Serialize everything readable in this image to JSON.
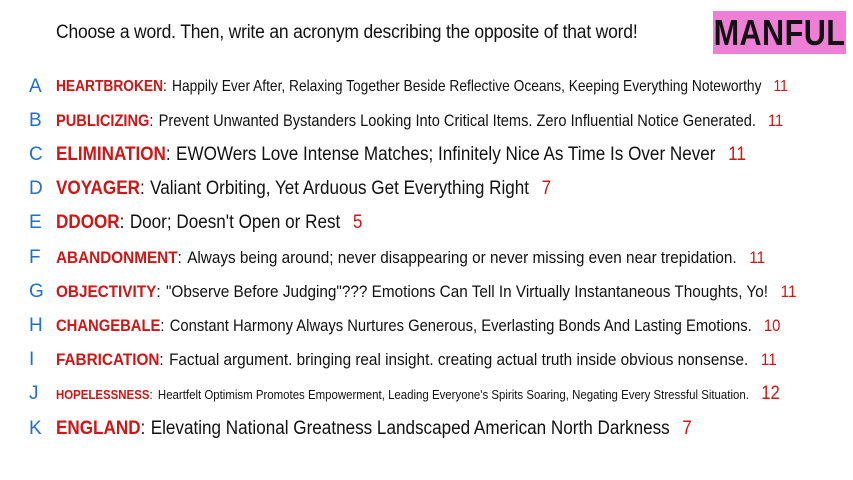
{
  "prompt": "Choose a word. Then, write an acronym describing the opposite of that word!",
  "title_word": "MANFUL",
  "rows": [
    {
      "letter": "A",
      "word": "HEARTBROKEN",
      "acronym": "Happily Ever After, Relaxing Together Beside Reflective Oceans, Keeping Everything Noteworthy",
      "score": "11"
    },
    {
      "letter": "B",
      "word": "PUBLICIZING",
      "acronym": "Prevent Unwanted Bystanders Looking Into Critical Items. Zero Influential Notice Generated.",
      "score": "11"
    },
    {
      "letter": "C",
      "word": "ELIMINATION",
      "acronym": "EWOWers Love Intense Matches; Infinitely Nice As Time Is Over Never",
      "score": "11"
    },
    {
      "letter": "D",
      "word": "VOYAGER",
      "acronym": "Valiant Orbiting, Yet Arduous Get Everything Right",
      "score": "7"
    },
    {
      "letter": "E",
      "word": "DDOOR",
      "acronym": "Door; Doesn't Open or Rest",
      "score": "5"
    },
    {
      "letter": "F",
      "word": "ABANDONMENT",
      "acronym": "Always being around; never disappearing or never missing even near trepidation.",
      "score": "11"
    },
    {
      "letter": "G",
      "word": "OBJECTIVITY",
      "acronym": "\"Observe Before Judging\"??? Emotions Can Tell In Virtually Instantaneous Thoughts, Yo!",
      "score": "11"
    },
    {
      "letter": "H",
      "word": "CHANGEBALE",
      "acronym": "Constant Harmony Always Nurtures Generous, Everlasting Bonds And Lasting Emotions.",
      "score": "10"
    },
    {
      "letter": "I",
      "word": "FABRICATION",
      "acronym": "Factual argument. bringing real insight. creating actual truth inside obvious nonsense.",
      "score": "11"
    },
    {
      "letter": "J",
      "word": "HOPELESSNESS",
      "acronym": "Heartfelt Optimism Promotes Empowerment, Leading Everyone's Spirits Soaring, Negating Every Stressful Situation.",
      "score": "12"
    },
    {
      "letter": "K",
      "word": "ENGLAND",
      "acronym": "Elevating National Greatness Landscaped American North Darkness",
      "score": "7"
    }
  ],
  "colors": {
    "letter": "#1f6fd0",
    "word": "#d01515",
    "score": "#d01515",
    "title_bg": "#ef7fd6"
  }
}
